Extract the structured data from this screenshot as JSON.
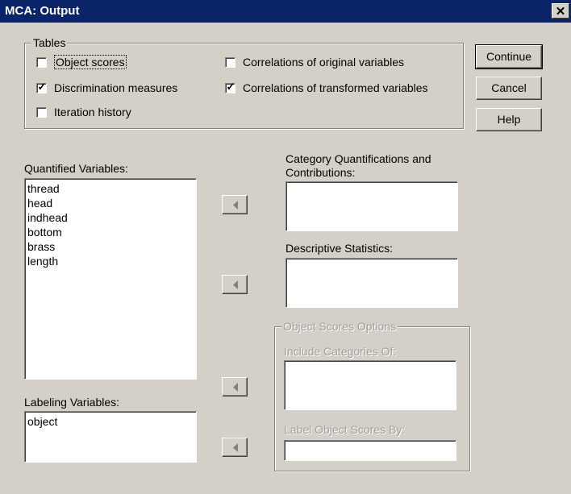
{
  "window": {
    "title": "MCA: Output",
    "close_glyph": "✕"
  },
  "tables_group": {
    "label": "Tables",
    "checkboxes": [
      {
        "label": "Object scores",
        "checked": false
      },
      {
        "label": "Discrimination measures",
        "checked": true
      },
      {
        "label": "Iteration history",
        "checked": false
      },
      {
        "label": "Correlations of original variables",
        "checked": false
      },
      {
        "label": "Correlations of transformed variables",
        "checked": true
      }
    ]
  },
  "buttons": {
    "continue": "Continue",
    "cancel": "Cancel",
    "help": "Help"
  },
  "quantified_variables": {
    "label": "Quantified Variables:",
    "items": [
      "thread",
      "head",
      "indhead",
      "bottom",
      "brass",
      "length"
    ]
  },
  "labeling_variables": {
    "label": "Labeling Variables:",
    "items": [
      "object"
    ]
  },
  "category_quantifications": {
    "label_line1": "Category Quantifications and",
    "label_line2": "Contributions:"
  },
  "descriptive_statistics": {
    "label": "Descriptive Statistics:"
  },
  "object_scores_options": {
    "label": "Object Scores Options",
    "include_categories_label": "Include Categories Of:",
    "label_scores_by_label": "Label Object Scores By:"
  },
  "icons": {
    "arrow": "left-arrow-icon",
    "check": "checkmark-icon"
  },
  "colors": {
    "titlebar": "#0a246a",
    "face": "#d4d0c8",
    "disabled_text": "#a0a0a0"
  }
}
